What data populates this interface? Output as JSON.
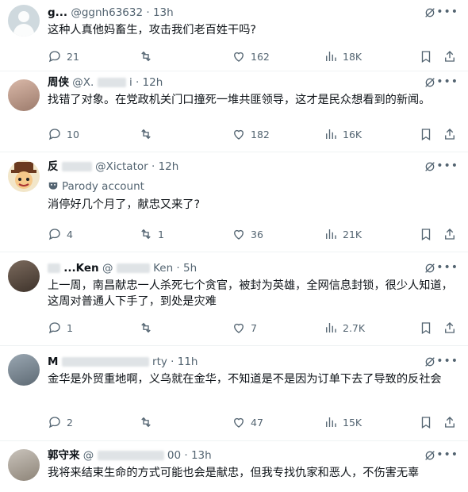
{
  "posts": [
    {
      "name": "g...",
      "handle": "@ggnh63632",
      "time": "· 13h",
      "text": "这种人真他妈畜生，攻击我们老百姓干吗?",
      "replies": "21",
      "reposts": "",
      "likes": "162",
      "views": "18K",
      "avatar": "av-default"
    },
    {
      "name": "周侠",
      "handle": "@X.",
      "time": "i · 12h",
      "text": "找错了对象。在党政机关门口撞死一堆共匪领导，这才是民众想看到的新闻。",
      "replies": "10",
      "reposts": "",
      "likes": "182",
      "views": "16K",
      "avatar": "av-face1"
    },
    {
      "name": "反",
      "handle": "@Xictator",
      "time": "· 12h",
      "parody": "Parody account",
      "text": "消停好几个月了，献忠又来了?",
      "replies": "4",
      "reposts": "1",
      "likes": "36",
      "views": "21K",
      "avatar": "av-cartoon"
    },
    {
      "name": "...Ken",
      "handle": "@",
      "time": "Ken · 5h",
      "text": "上一周，南昌献忠一人杀死七个贪官，被封为英雄，全网信息封锁，很少人知道，这周对普通人下手了，到处是灾难",
      "replies": "1",
      "reposts": "",
      "likes": "7",
      "views": "2.7K",
      "avatar": "av-face2"
    },
    {
      "name": "M",
      "handle": "",
      "time": "rty · 11h",
      "text": "金华是外贸重地啊，义乌就在金华，不知道是不是因为订单下去了导致的反社会",
      "replies": "2",
      "reposts": "",
      "likes": "47",
      "views": "15K",
      "avatar": "av-face3"
    },
    {
      "name": "郭守来",
      "handle": "@",
      "time": "00 · 13h",
      "text": "我将来结束生命的方式可能也会是献忠，但我专找仇家和恶人，不伤害无辜",
      "replies": "",
      "reposts": "",
      "likes": "",
      "views": "",
      "avatar": "av-face4"
    }
  ]
}
